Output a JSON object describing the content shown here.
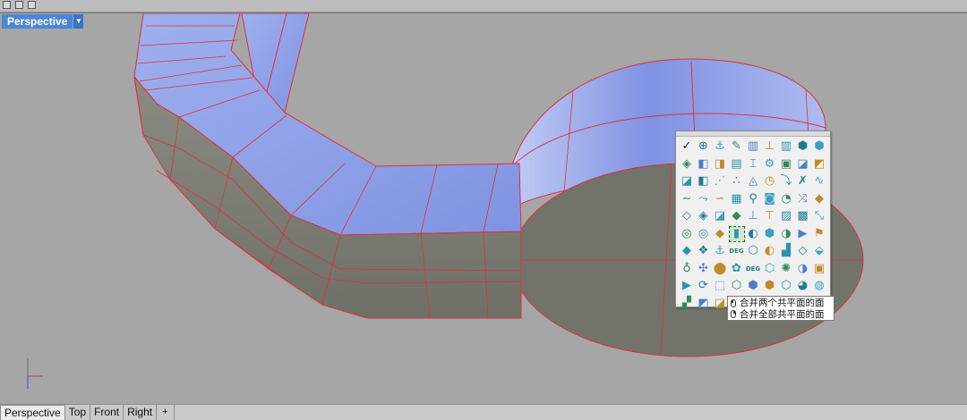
{
  "viewport": {
    "title": "Perspective"
  },
  "tabs": [
    {
      "label": "Perspective",
      "active": true
    },
    {
      "label": "Top",
      "active": false
    },
    {
      "label": "Front",
      "active": false
    },
    {
      "label": "Right",
      "active": false
    }
  ],
  "add_tab_symbol": "+",
  "toolbar_icons": [
    "✓",
    "⊕",
    "⚓",
    "✎",
    "▥",
    "⊥",
    "▥",
    "⬢",
    "⬢",
    "◈",
    "◧",
    "◨",
    "▤",
    "⌶",
    "⚙",
    "▣",
    "◪",
    "◩",
    "◪",
    "◧",
    "⋰",
    "∴",
    "◬",
    "◷",
    "⤵",
    "✗",
    "∿",
    "∼",
    "⤳",
    "∽",
    "▦",
    "⚲",
    "◙",
    "◔",
    "⤨",
    "◆",
    "◇",
    "◈",
    "◪",
    "◆",
    "⊥",
    "⊤",
    "▨",
    "▩",
    "⤡",
    "◎",
    "◎",
    "◆",
    "▮",
    "◐",
    "⬢",
    "◑",
    "▶",
    "⚑",
    "◆",
    "❖",
    "⚓",
    "DEG",
    "⬡",
    "◐",
    "▟",
    "◇",
    "⬙",
    "♁",
    "✣",
    "⬤",
    "✿",
    "DEG",
    "⬡",
    "✺",
    "◑",
    "▣",
    "▶",
    "⟳",
    "⬚",
    "⬡",
    "⬢",
    "⬢",
    "⬡",
    "◕",
    "◍",
    "▞",
    "◩",
    "◪",
    "◈",
    "◕",
    "◔",
    "◍",
    "⬣",
    "⚙"
  ],
  "selected_icon_index": 48,
  "tooltip": {
    "line1": "合并两个共平面的面",
    "line2": "合并全部共平面的面"
  },
  "colors": {
    "viewport_bg": "#a6a6a6",
    "active_title": "#4d86d6",
    "surface_blue": "#8e9fe6",
    "surface_gray": "#7d7f76",
    "edge_red": "#e0303a"
  }
}
